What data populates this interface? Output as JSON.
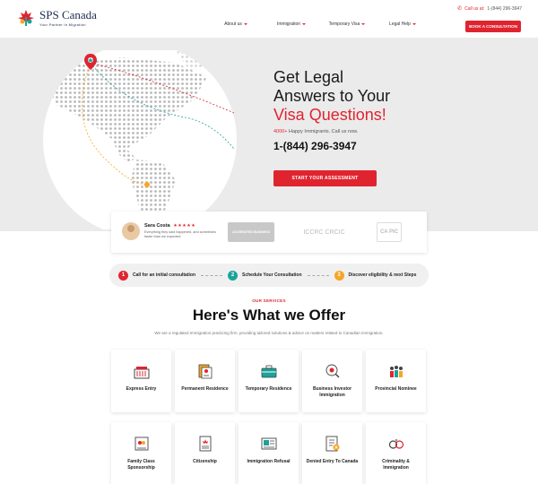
{
  "brand": {
    "name": "SPS Canada",
    "tagline": "Your Partner In Migration",
    "colors": {
      "accent": "#e0242f",
      "navy": "#1d2b4f",
      "teal": "#1aa39a",
      "orange": "#f5a623"
    }
  },
  "topbar": {
    "call_prefix": "Call us at:",
    "call_number": "1-(844) 296-3947"
  },
  "nav": {
    "items": [
      {
        "label": "About us"
      },
      {
        "label": "Immigration"
      },
      {
        "label": "Temporary Visa"
      },
      {
        "label": "Legal Help"
      }
    ],
    "cta": "BOOK A CONSULTATION"
  },
  "hero": {
    "title_line1": "Get Legal",
    "title_line2": "Answers to Your",
    "title_line3": "Visa Questions!",
    "sub_highlight": "4000+",
    "sub_rest": "Happy Immigrants. Call us now.",
    "phone": "1-(844) 296-3947",
    "cta": "START YOUR ASSESSMENT"
  },
  "testimonial": {
    "name": "Sara Costa",
    "stars": "★★★★★",
    "text": "Everything they said happened, and sometimes faster than we expected",
    "badges": {
      "bbb": "ACCREDITED BUSINESS",
      "iccrc": "ICCRC CRCIC",
      "capic": "CA PIC"
    }
  },
  "steps": [
    {
      "num": "1",
      "label": "Call for an initial consultation",
      "color": "#e0242f"
    },
    {
      "num": "2",
      "label": "Schedule Your Consultation",
      "color": "#1aa39a"
    },
    {
      "num": "3",
      "label": "Discover eligibility & next Steps",
      "color": "#f5a623"
    }
  ],
  "services": {
    "kicker": "OUR SERVICES",
    "title": "Here's What we Offer",
    "description": "We are a regulated Immigration practicing firm, providing tailored solutions & advice on matters related to Canadian immigration.",
    "items": [
      {
        "label": "Express Entry",
        "icon": "express-entry-icon"
      },
      {
        "label": "Permanent Residence",
        "icon": "permanent-residence-icon"
      },
      {
        "label": "Temporary Residence",
        "icon": "temporary-residence-icon"
      },
      {
        "label": "Business Investor Immigration",
        "icon": "business-investor-icon"
      },
      {
        "label": "Provincial Nominee",
        "icon": "provincial-nominee-icon"
      },
      {
        "label": "Family Class Sponsorship",
        "icon": "family-sponsorship-icon"
      },
      {
        "label": "Citizenship",
        "icon": "citizenship-icon"
      },
      {
        "label": "Immigration Refusal",
        "icon": "immigration-refusal-icon"
      },
      {
        "label": "Denied Entry To Canada",
        "icon": "denied-entry-icon"
      },
      {
        "label": "Criminality & Immigration",
        "icon": "criminality-icon"
      }
    ]
  }
}
